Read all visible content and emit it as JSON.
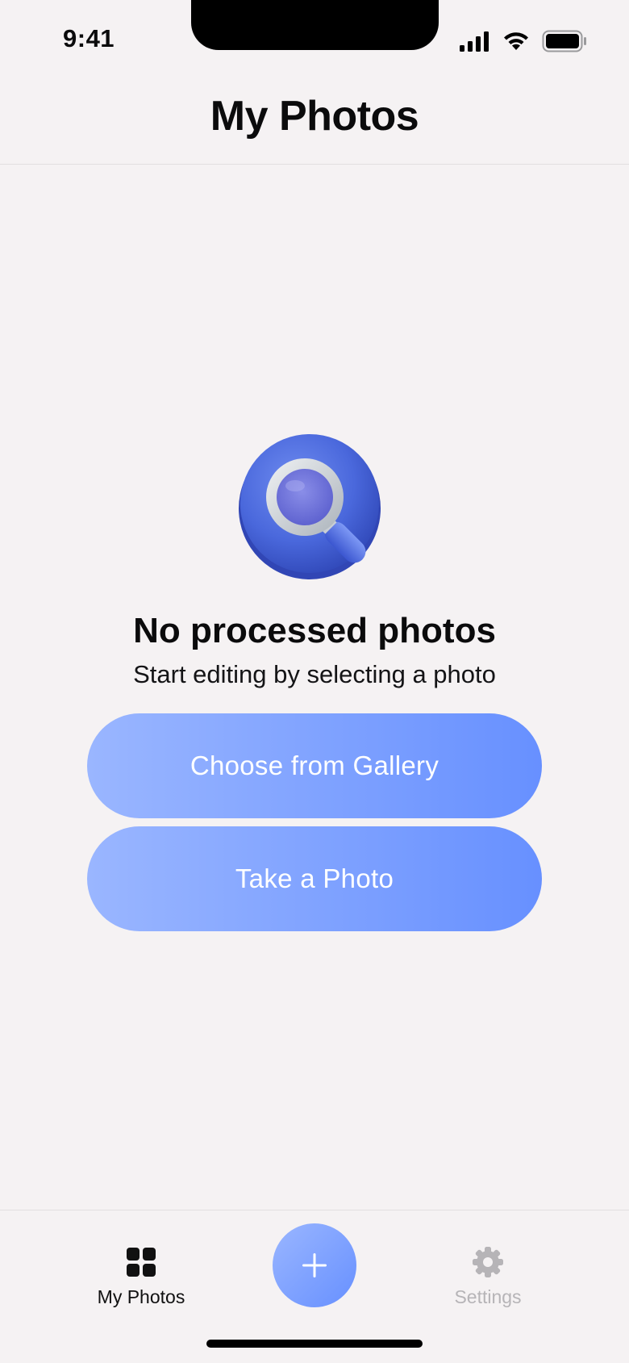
{
  "status_bar": {
    "time": "9:41",
    "icons": [
      "cellular-signal-icon",
      "wifi-icon",
      "battery-icon"
    ]
  },
  "header": {
    "title": "My Photos"
  },
  "empty_state": {
    "illustration": "magnifying-glass-icon",
    "title": "No processed photos",
    "subtitle": "Start editing by selecting a photo"
  },
  "actions": {
    "gallery_label": "Choose from Gallery",
    "camera_label": "Take a Photo"
  },
  "tab_bar": {
    "photos_label": "My Photos",
    "photos_icon": "grid-icon",
    "add_icon": "plus-icon",
    "settings_label": "Settings",
    "settings_icon": "gear-icon"
  },
  "colors": {
    "background": "#f5f2f3",
    "accent_start": "#9ab6ff",
    "accent_end": "#6790ff",
    "inactive_tab": "#b6b4b7"
  }
}
